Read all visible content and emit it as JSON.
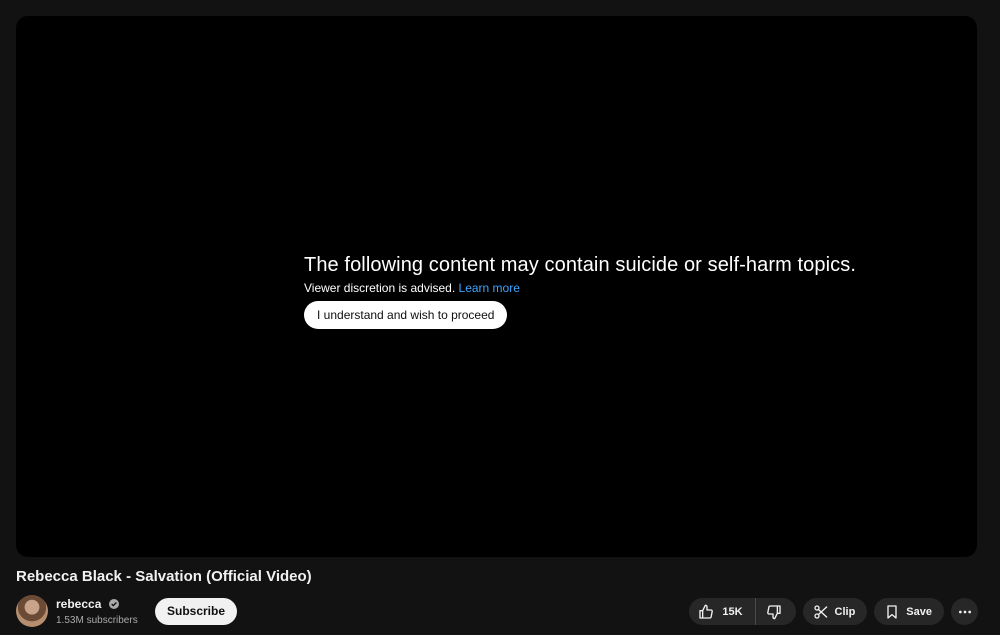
{
  "warning": {
    "title": "The following content may contain suicide or self-harm topics.",
    "subtitle": "Viewer discretion is advised.",
    "learn_more": "Learn more",
    "proceed_label": "I understand and wish to proceed"
  },
  "video": {
    "title": "Rebecca Black - Salvation (Official Video)"
  },
  "channel": {
    "name": "rebecca",
    "subscribers": "1.53M subscribers",
    "subscribe_label": "Subscribe"
  },
  "actions": {
    "like_count": "15K",
    "clip_label": "Clip",
    "save_label": "Save"
  },
  "icons": {
    "like": "thumbs-up-icon",
    "dislike": "thumbs-down-icon",
    "clip": "scissors-icon",
    "save": "bookmark-icon",
    "more": "more-horizontal-icon",
    "verified": "verified-check-icon"
  },
  "colors": {
    "link": "#3ea6ff",
    "background": "#0f0f0f",
    "player": "#000000",
    "pill": "#272727"
  }
}
